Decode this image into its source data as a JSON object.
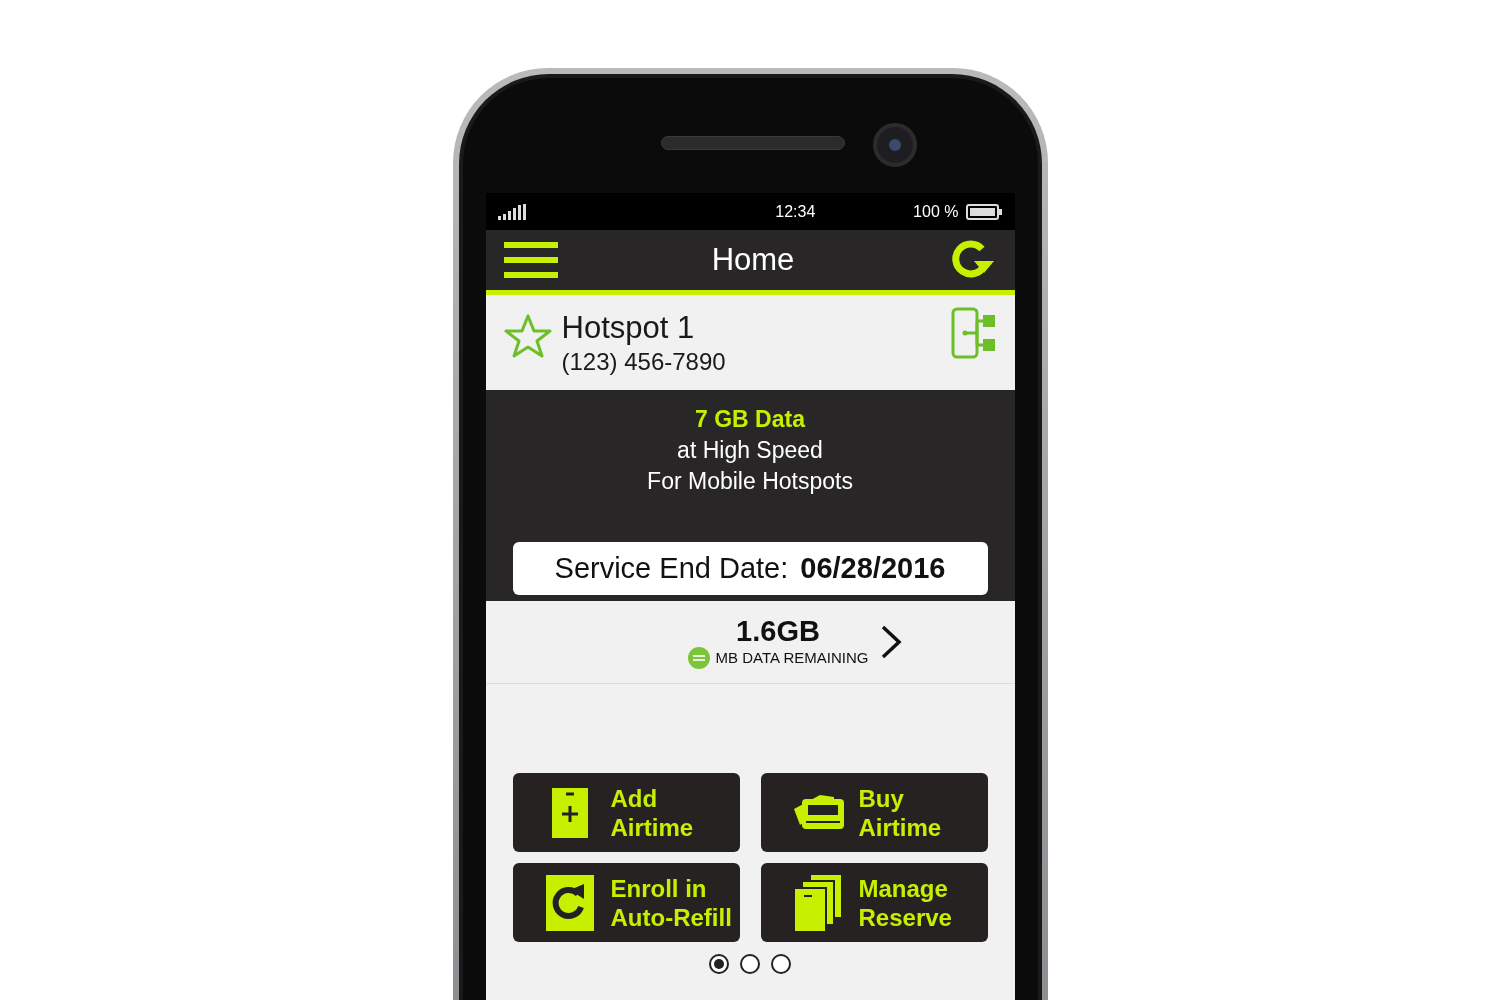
{
  "status_bar": {
    "time": "12:34",
    "battery": "100 %"
  },
  "header": {
    "title": "Home"
  },
  "account": {
    "name": "Hotspot 1",
    "phone": "(123) 456-7890",
    "starred": false
  },
  "plan": [
    {
      "text": "7 GB Data",
      "kind": "headline"
    },
    {
      "text": "at High Speed",
      "kind": "body"
    },
    {
      "text": "For Mobile Hotspots",
      "kind": "body"
    }
  ],
  "service_end": {
    "label": "Service End Date:",
    "value": "06/28/2016"
  },
  "data_remaining": {
    "amount": "1.6GB",
    "label": "MB DATA REMAINING"
  },
  "actions": [
    {
      "kind": "add",
      "lines": [
        "Add",
        "Airtime"
      ]
    },
    {
      "kind": "buy",
      "lines": [
        "Buy",
        "Airtime"
      ]
    },
    {
      "kind": "refill",
      "lines": [
        "Enroll in",
        "Auto-Refill"
      ]
    },
    {
      "kind": "reserve",
      "lines": [
        "Manage",
        "Reserve"
      ]
    }
  ],
  "pager": [
    {
      "selected": true
    },
    {
      "selected": false
    },
    {
      "selected": false
    }
  ]
}
